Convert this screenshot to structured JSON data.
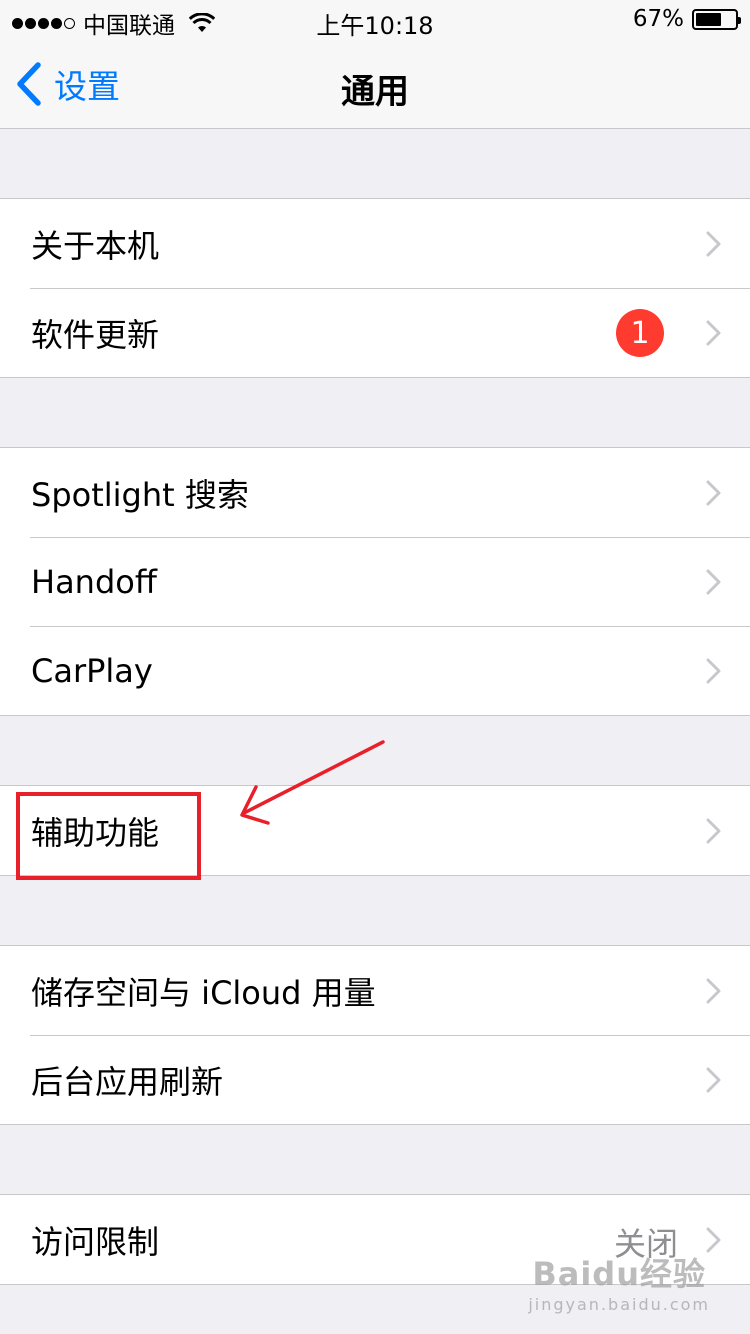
{
  "status_bar": {
    "carrier": "中国联通",
    "time": "上午10:18",
    "battery_percent": "67%",
    "battery_level": 0.67,
    "signal_bars_filled": 4
  },
  "nav": {
    "back_label": "设置",
    "title": "通用"
  },
  "groups": [
    {
      "rows": [
        {
          "label": "关于本机"
        },
        {
          "label": "软件更新",
          "badge": "1"
        }
      ]
    },
    {
      "rows": [
        {
          "label": "Spotlight 搜索"
        },
        {
          "label": "Handoff"
        },
        {
          "label": "CarPlay"
        }
      ]
    },
    {
      "rows": [
        {
          "label": "辅助功能"
        }
      ]
    },
    {
      "rows": [
        {
          "label": "储存空间与 iCloud 用量"
        },
        {
          "label": "后台应用刷新"
        }
      ]
    },
    {
      "rows": [
        {
          "label": "访问限制",
          "value": "关闭"
        }
      ]
    }
  ],
  "colors": {
    "accent": "#007aff",
    "badge": "#ff3b30",
    "annotation": "#e8202a",
    "background": "#efeff4"
  },
  "watermark": {
    "main": "Baidu经验",
    "sub": "jingyan.baidu.com"
  }
}
